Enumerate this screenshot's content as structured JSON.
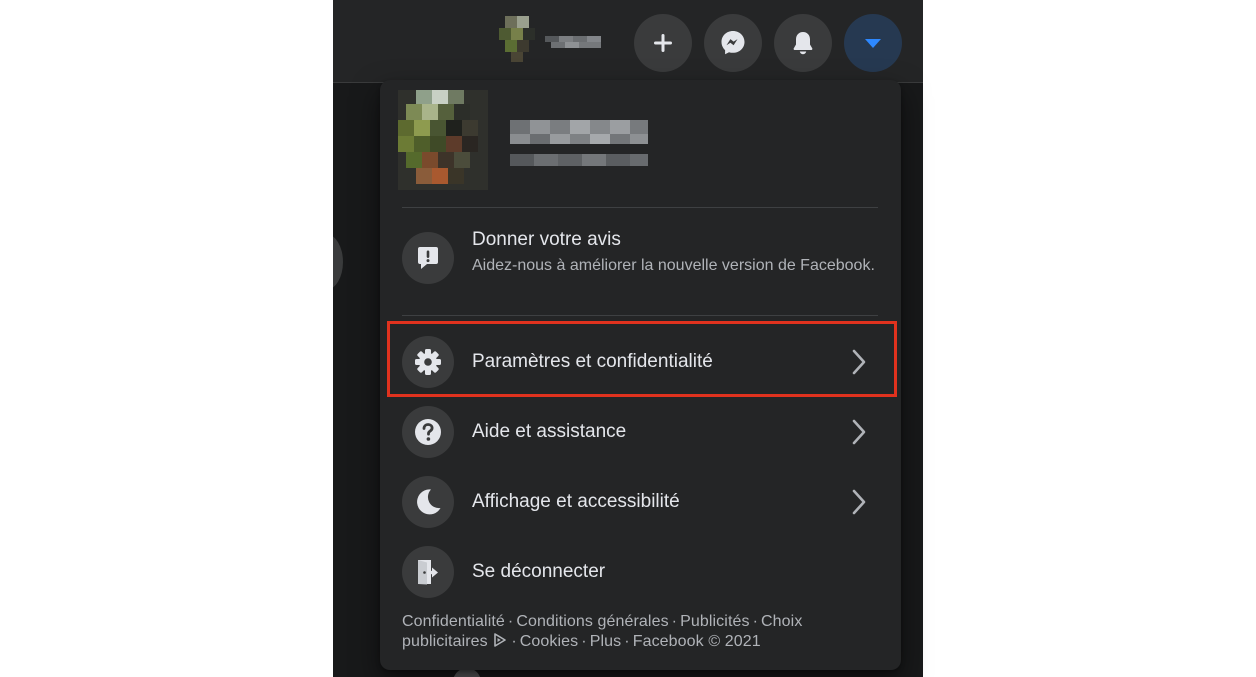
{
  "topbar": {
    "buttons": [
      {
        "name": "create",
        "icon": "plus-icon"
      },
      {
        "name": "messenger",
        "icon": "messenger-icon"
      },
      {
        "name": "notifications",
        "icon": "bell-icon"
      },
      {
        "name": "account",
        "icon": "caret-down-icon"
      }
    ]
  },
  "menu": {
    "feedback": {
      "title": "Donner votre avis",
      "description": "Aidez-nous à améliorer la nouvelle version de Facebook.",
      "icon": "feedback-icon"
    },
    "items": [
      {
        "label": "Paramètres et confidentialité",
        "icon": "gear-icon",
        "has_arrow": true,
        "highlighted": true
      },
      {
        "label": "Aide et assistance",
        "icon": "question-icon",
        "has_arrow": true
      },
      {
        "label": "Affichage et accessibilité",
        "icon": "moon-icon",
        "has_arrow": true
      },
      {
        "label": "Se déconnecter",
        "icon": "logout-icon",
        "has_arrow": false
      }
    ],
    "footer": {
      "links": [
        "Confidentialité",
        "Conditions générales",
        "Publicités",
        "Choix publicitaires",
        "Cookies",
        "Plus"
      ],
      "copyright": "Facebook © 2021"
    }
  },
  "colors": {
    "background": "#18191a",
    "surface": "#242526",
    "icon_bg": "#3a3b3c",
    "text_primary": "#e4e6eb",
    "text_secondary": "#b0b3b8",
    "accent": "#2d88ff",
    "highlight_border": "#e0321e"
  },
  "sep": "·"
}
